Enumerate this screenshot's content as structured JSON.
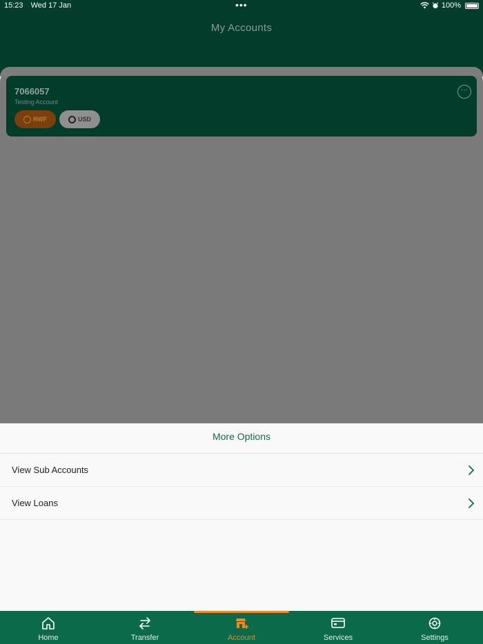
{
  "status": {
    "time": "15:23",
    "date": "Wed 17 Jan",
    "battery": "100%"
  },
  "header": {
    "title": "My Accounts"
  },
  "account": {
    "number": "7066057",
    "name": "Testing Account",
    "currencies": [
      "RWF",
      "USD"
    ],
    "selected_currency": "RWF"
  },
  "sheet": {
    "title": "More Options",
    "items": [
      {
        "label": "View Sub Accounts"
      },
      {
        "label": "View Loans"
      }
    ]
  },
  "tabs": [
    {
      "label": "Home",
      "icon": "home-icon"
    },
    {
      "label": "Transfer",
      "icon": "transfer-icon"
    },
    {
      "label": "Account",
      "icon": "account-icon"
    },
    {
      "label": "Services",
      "icon": "card-icon"
    },
    {
      "label": "Settings",
      "icon": "gear-icon"
    }
  ],
  "active_tab": "Account",
  "colors": {
    "brand_green": "#0a6a49",
    "accent_orange": "#f08a1e"
  }
}
